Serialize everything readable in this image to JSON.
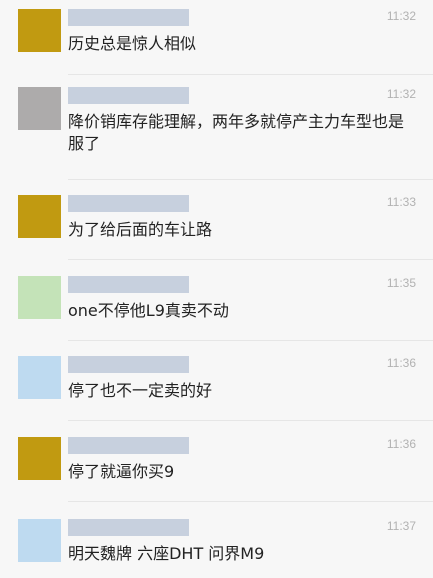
{
  "comments": [
    {
      "avatar_color": "#c19a11",
      "time": "11:32",
      "text": "历史总是惊人相似"
    },
    {
      "avatar_color": "#adabab",
      "time": "11:32",
      "text": "降价销库存能理解，两年多就停产主力车型也是服了"
    },
    {
      "avatar_color": "#c19a11",
      "time": "11:33",
      "text": "为了给后面的车让路"
    },
    {
      "avatar_color": "#c4e3b8",
      "time": "11:35",
      "text": "one不停他L9真卖不动"
    },
    {
      "avatar_color": "#bedaf0",
      "time": "11:36",
      "text": "停了也不一定卖的好"
    },
    {
      "avatar_color": "#c19a11",
      "time": "11:36",
      "text": "停了就逼你买9"
    },
    {
      "avatar_color": "#bedaf0",
      "time": "11:37",
      "text": "明天魏牌  六座DHT 问界M9"
    }
  ]
}
